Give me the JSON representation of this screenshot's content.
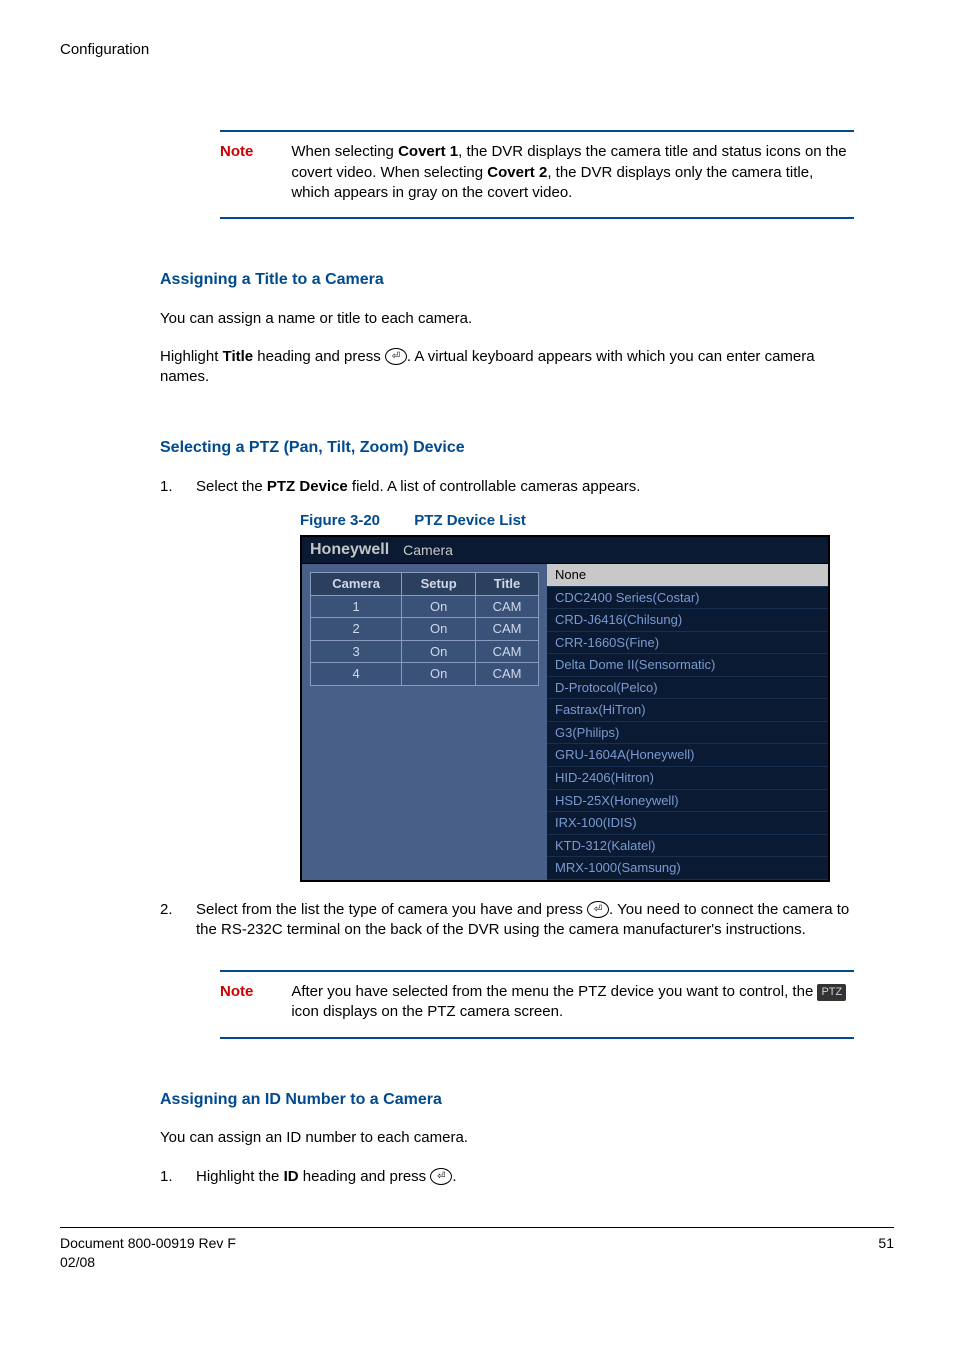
{
  "header": {
    "section": "Configuration"
  },
  "note1": {
    "label": "Note",
    "text_parts": {
      "p1": "When selecting ",
      "b1": "Covert 1",
      "p2": ", the DVR displays the camera title and status icons on the covert video. When selecting ",
      "b2": "Covert 2",
      "p3": ", the DVR displays only the camera title, which appears in gray on the covert video."
    }
  },
  "assign_title": {
    "heading": "Assigning a Title to a Camera",
    "p1": "You can assign a name or title to each camera.",
    "p2": {
      "a": "Highlight ",
      "b": "Title",
      "c": " heading and press ",
      "d": ". A virtual keyboard appears with which you can enter camera names."
    }
  },
  "ptz_section": {
    "heading": "Selecting a PTZ (Pan, Tilt, Zoom) Device",
    "step1": {
      "num": "1.",
      "a": "Select the ",
      "b": "PTZ Device",
      "c": " field. A list of controllable cameras appears."
    },
    "figure": {
      "label_left": "Figure 3-20",
      "label_right": "PTZ Device List",
      "brand": "Honeywell",
      "tab": "Camera",
      "left_table": {
        "headers": [
          "Camera",
          "Setup",
          "Title"
        ],
        "rows": [
          {
            "cam": "1",
            "setup": "On",
            "title": "CAM"
          },
          {
            "cam": "2",
            "setup": "On",
            "title": "CAM"
          },
          {
            "cam": "3",
            "setup": "On",
            "title": "CAM"
          },
          {
            "cam": "4",
            "setup": "On",
            "title": "CAM"
          }
        ]
      },
      "options": [
        {
          "label": "None",
          "selected": true
        },
        {
          "label": "CDC2400 Series(Costar)"
        },
        {
          "label": "CRD-J6416(Chilsung)"
        },
        {
          "label": "CRR-1660S(Fine)"
        },
        {
          "label": "Delta Dome II(Sensormatic)"
        },
        {
          "label": "D-Protocol(Pelco)"
        },
        {
          "label": "Fastrax(HiTron)"
        },
        {
          "label": "G3(Philips)"
        },
        {
          "label": "GRU-1604A(Honeywell)"
        },
        {
          "label": "HID-2406(Hitron)"
        },
        {
          "label": "HSD-25X(Honeywell)"
        },
        {
          "label": "IRX-100(IDIS)"
        },
        {
          "label": "KTD-312(Kalatel)"
        },
        {
          "label": "MRX-1000(Samsung)"
        }
      ]
    },
    "step2": {
      "num": "2.",
      "a": "Select from the list the type of camera you have and press ",
      "b": ". You need to connect the camera to the RS-232C terminal on the back of the DVR using the camera manufacturer's instructions."
    }
  },
  "note2": {
    "label": "Note",
    "a": "After you have selected from the menu the PTZ device you want to control, the ",
    "ptz_icon_text": "PTZ",
    "b": " icon displays on the PTZ camera screen."
  },
  "assign_id": {
    "heading": "Assigning an ID Number to a Camera",
    "p1": "You can assign an ID number to each camera.",
    "step1": {
      "num": "1.",
      "a": "Highlight the ",
      "b": "ID",
      "c": " heading and press ",
      "d": "."
    }
  },
  "footer": {
    "left1": "Document 800-00919 Rev F",
    "left2": "02/08",
    "right": "51"
  }
}
